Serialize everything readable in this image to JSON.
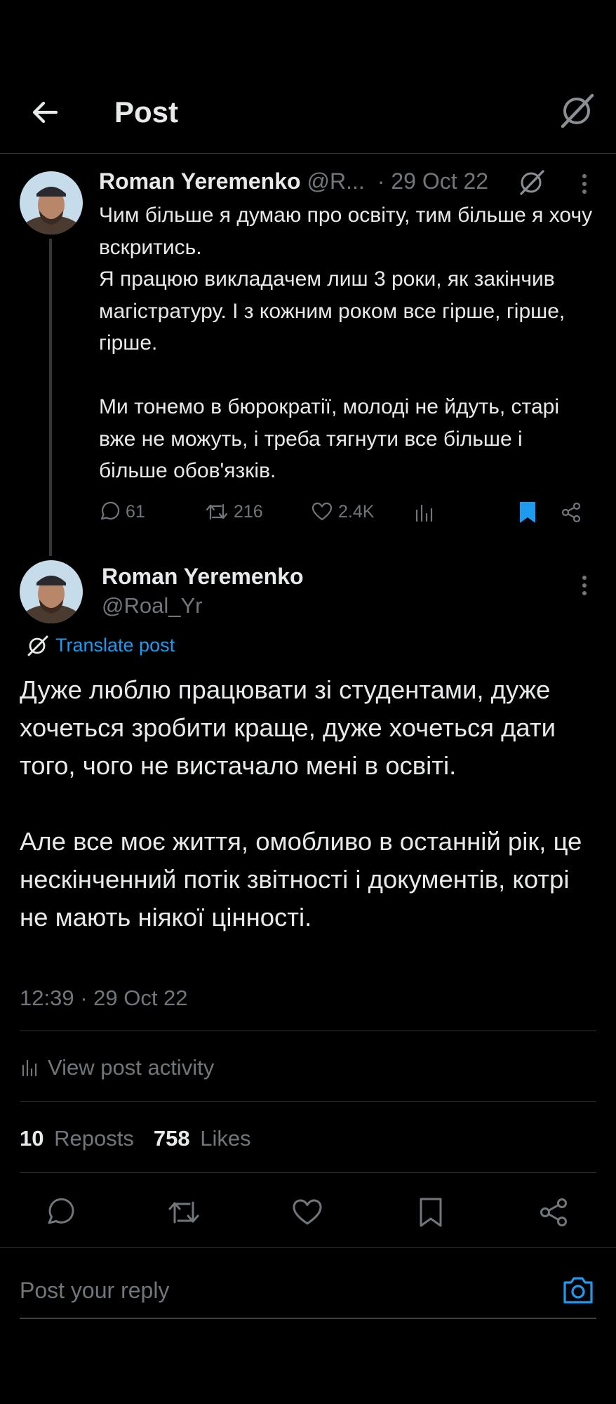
{
  "header": {
    "title": "Post"
  },
  "parent_post": {
    "author_name": "Roman Yeremenko",
    "handle": "@R...",
    "date": "· 29 Oct 22",
    "paragraphs": [
      "Чим більше я думаю про освіту, тим більше я хочу вскритись.",
      "Я працюю викладачем лиш 3 роки, як закінчив магістратуру. І з кожним роком все гірше, гірше, гірше.",
      "",
      "Ми тонемо в бюрократії, молоді не йдуть, старі вже не можуть, і треба тягнути все більше і більше обов'язків."
    ],
    "replies": "61",
    "reposts": "216",
    "likes": "2.4K"
  },
  "main_post": {
    "author_name": "Roman Yeremenko",
    "handle": "@Roal_Yr",
    "translate_label": "Translate post",
    "paragraphs": [
      "Дуже люблю працювати зі студентами, дуже хочеться зробити краще, дуже хочеться дати того, чого не вистачало мені в освіті.",
      "",
      "Але все моє життя, омобливо в останній рік, це нескінченний потік звітності і документів, котрі не мають ніякої цінності."
    ],
    "timestamp": "12:39 · 29 Oct 22",
    "activity_label": "View post activity",
    "reposts_count": "10",
    "reposts_label": "Reposts",
    "likes_count": "758",
    "likes_label": "Likes"
  },
  "reply": {
    "placeholder": "Post your reply"
  },
  "colors": {
    "accent": "#1d9bf0",
    "background": "#000000",
    "muted": "#71767b",
    "divider": "#2f3336"
  }
}
